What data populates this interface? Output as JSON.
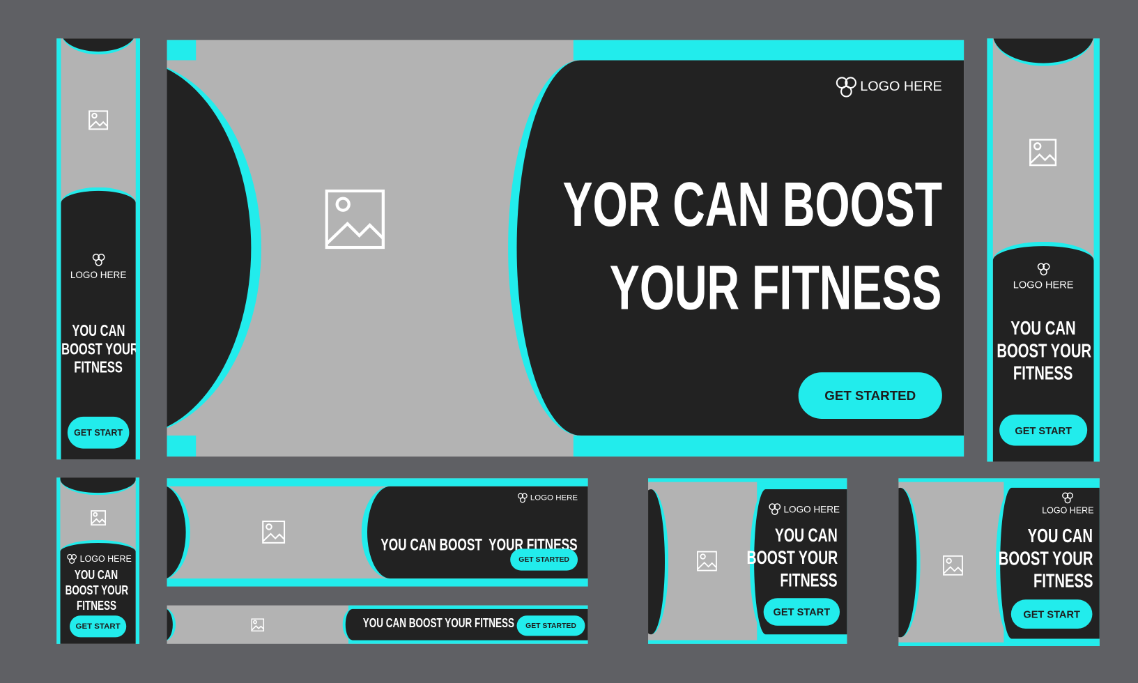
{
  "colors": {
    "background": "#5f6064",
    "accent": "#22ecec",
    "panel": "#222222",
    "image_area": "#b3b3b3",
    "text": "#ffffff"
  },
  "icons": {
    "logo": "trefoil-logo-icon",
    "image": "image-placeholder-icon"
  },
  "banners": {
    "main": {
      "logo": "LOGO HERE",
      "headline": [
        "YOR CAN BOOST",
        "YOUR FITNESS"
      ],
      "button": "GET STARTED"
    },
    "tall_left": {
      "logo": "LOGO HERE",
      "headline": [
        "YOU CAN",
        "BOOST YOUR",
        "FITNESS"
      ],
      "button": "GET START"
    },
    "tall_right": {
      "logo": "LOGO HERE",
      "headline": [
        "YOU CAN",
        "BOOST YOUR",
        "FITNESS"
      ],
      "button": "GET START"
    },
    "small_vertical": {
      "logo": "LOGO HERE",
      "headline": [
        "YOU CAN",
        "BOOST YOUR",
        "FITNESS"
      ],
      "button": "GET START"
    },
    "wide_medium": {
      "logo": "LOGO HERE",
      "headline": "YOU CAN BOOST  YOUR FITNESS",
      "button": "GET STARTED"
    },
    "wide_thin": {
      "headline": "YOU CAN BOOST YOUR FITNESS",
      "button": "GET STARTED"
    },
    "square_left": {
      "logo": "LOGO HERE",
      "headline": [
        "YOU CAN",
        "BOOST YOUR",
        "FITNESS"
      ],
      "button": "GET START"
    },
    "square_right": {
      "logo": "LOGO HERE",
      "headline": [
        "YOU CAN",
        "BOOST YOUR",
        "FITNESS"
      ],
      "button": "GET START"
    }
  }
}
